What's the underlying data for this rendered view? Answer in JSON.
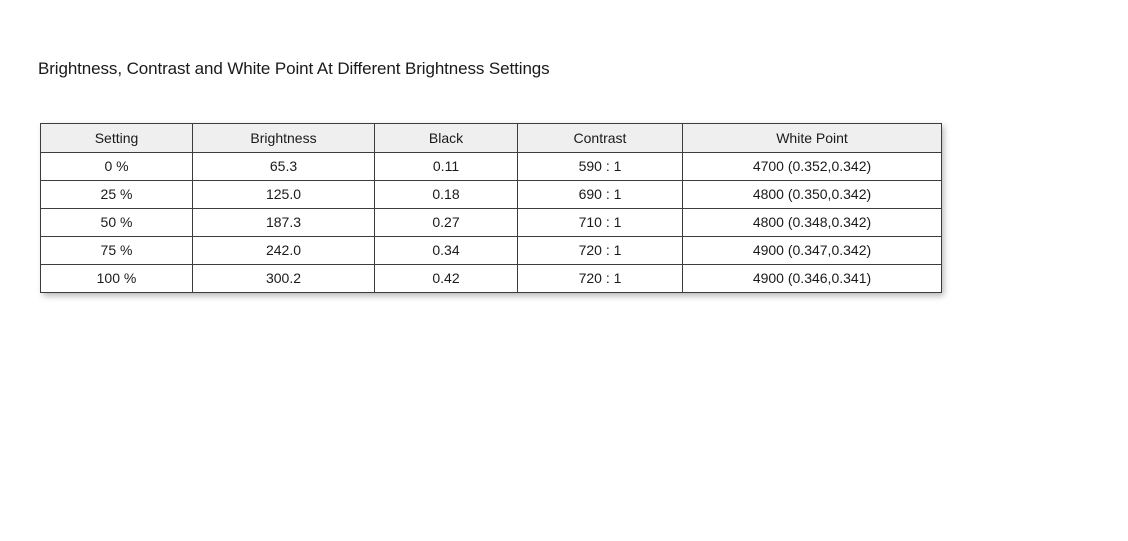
{
  "document": {
    "title": "Brightness, Contrast and White Point At Different Brightness Settings"
  },
  "table": {
    "headers": [
      "Setting",
      "Brightness",
      "Black",
      "Contrast",
      "White Point"
    ],
    "rows": [
      [
        "0 %",
        "65.3",
        "0.11",
        "590 : 1",
        "4700 (0.352,0.342)"
      ],
      [
        "25 %",
        "125.0",
        "0.18",
        "690 : 1",
        "4800 (0.350,0.342)"
      ],
      [
        "50 %",
        "187.3",
        "0.27",
        "710 : 1",
        "4800 (0.348,0.342)"
      ],
      [
        "75 %",
        "242.0",
        "0.34",
        "720 : 1",
        "4900 (0.347,0.342)"
      ],
      [
        "100 %",
        "300.2",
        "0.42",
        "720 : 1",
        "4900 (0.346,0.341)"
      ]
    ]
  },
  "chart_data": {
    "type": "table",
    "title": "Brightness, Contrast and White Point At Different Brightness Settings",
    "columns": [
      "Setting",
      "Brightness",
      "Black",
      "Contrast",
      "White Point"
    ],
    "categories": [
      "0 %",
      "25 %",
      "50 %",
      "75 %",
      "100 %"
    ],
    "series": [
      {
        "name": "Brightness",
        "values": [
          65.3,
          125.0,
          187.3,
          242.0,
          300.2
        ]
      },
      {
        "name": "Black",
        "values": [
          0.11,
          0.18,
          0.27,
          0.34,
          0.42
        ]
      },
      {
        "name": "Contrast",
        "values": [
          590,
          690,
          710,
          720,
          720
        ]
      },
      {
        "name": "White Point (K)",
        "values": [
          4700,
          4800,
          4800,
          4900,
          4900
        ]
      },
      {
        "name": "White Point x",
        "values": [
          0.352,
          0.35,
          0.348,
          0.347,
          0.346
        ]
      },
      {
        "name": "White Point y",
        "values": [
          0.342,
          0.342,
          0.342,
          0.342,
          0.341
        ]
      }
    ],
    "xlabel": "Setting",
    "ylabel": "",
    "grid": true,
    "legend": "none",
    "colors": {
      "header_background": "#efefef",
      "cell_background": "#ffffff",
      "border": "#3c3c3c",
      "text": "#1a1a1a",
      "page_background": "#ffffff"
    }
  }
}
